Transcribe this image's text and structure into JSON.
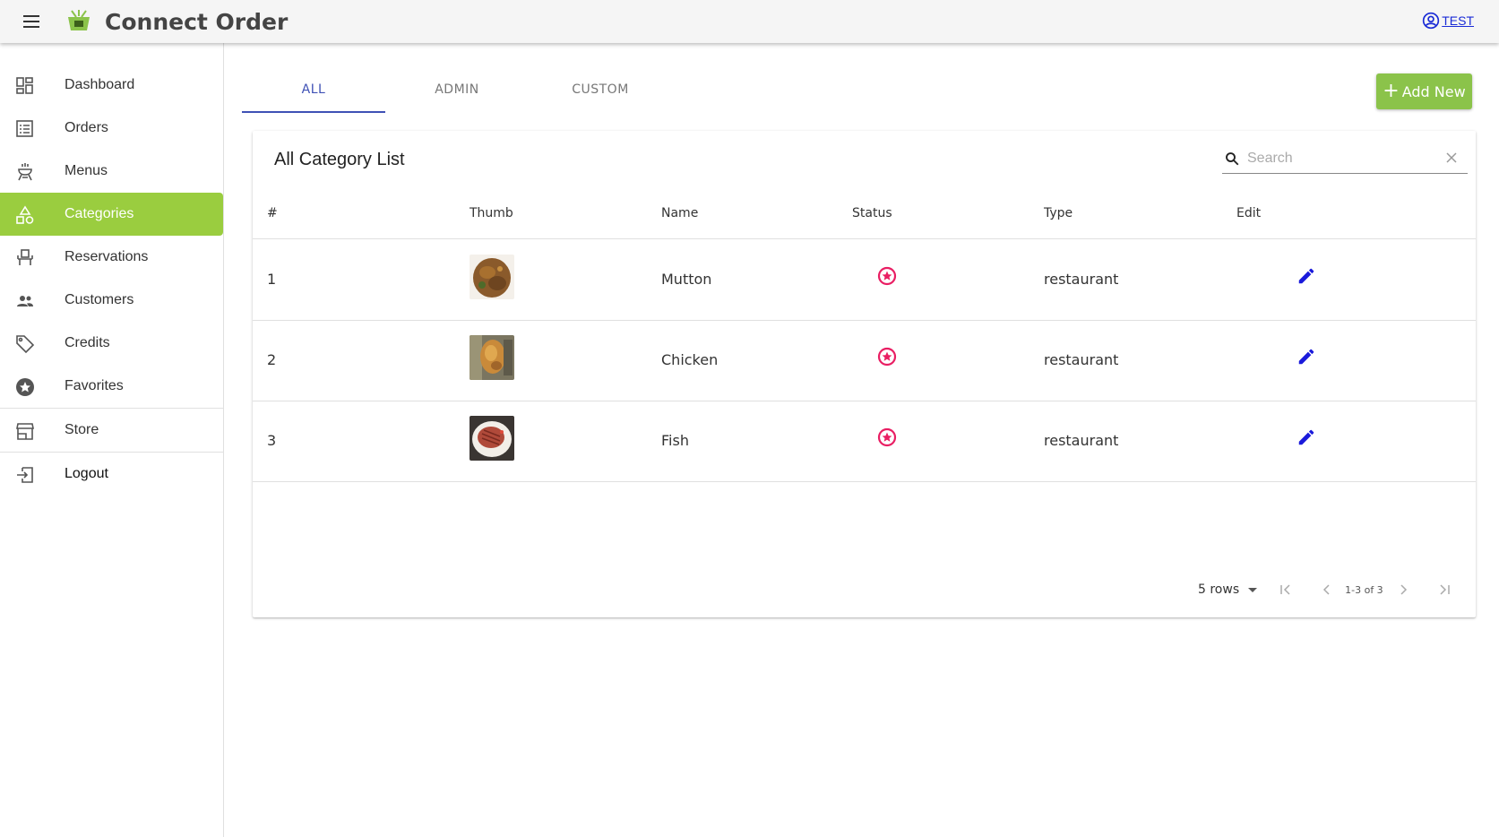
{
  "header": {
    "brand": "Connect Order",
    "user": "TEST"
  },
  "sidebar": {
    "items": [
      {
        "label": "Dashboard",
        "icon": "dashboard-icon"
      },
      {
        "label": "Orders",
        "icon": "list-icon"
      },
      {
        "label": "Menus",
        "icon": "grill-icon"
      },
      {
        "label": "Categories",
        "icon": "category-icon",
        "active": true
      },
      {
        "label": "Reservations",
        "icon": "seat-icon"
      },
      {
        "label": "Customers",
        "icon": "people-icon"
      },
      {
        "label": "Credits",
        "icon": "tag-icon"
      },
      {
        "label": "Favorites",
        "icon": "star-icon"
      },
      {
        "label": "Store",
        "icon": "store-icon"
      },
      {
        "label": "Logout",
        "icon": "logout-icon"
      }
    ]
  },
  "tabs": [
    {
      "label": "ALL",
      "active": true
    },
    {
      "label": "ADMIN"
    },
    {
      "label": "CUSTOM"
    }
  ],
  "add_button": "Add New",
  "card": {
    "title": "All Category List",
    "search_placeholder": "Search"
  },
  "table": {
    "headers": [
      "#",
      "Thumb",
      "Name",
      "Status",
      "Type",
      "Edit"
    ],
    "rows": [
      {
        "index": "1",
        "name": "Mutton",
        "type": "restaurant"
      },
      {
        "index": "2",
        "name": "Chicken",
        "type": "restaurant"
      },
      {
        "index": "3",
        "name": "Fish",
        "type": "restaurant"
      }
    ]
  },
  "pagination": {
    "rows_per_page": "5 rows",
    "range": "1-3 of 3"
  },
  "colors": {
    "accent": "#9acd3f",
    "tab_active": "#3f51b5",
    "status": "#e91e63",
    "edit": "#1a1adb"
  }
}
